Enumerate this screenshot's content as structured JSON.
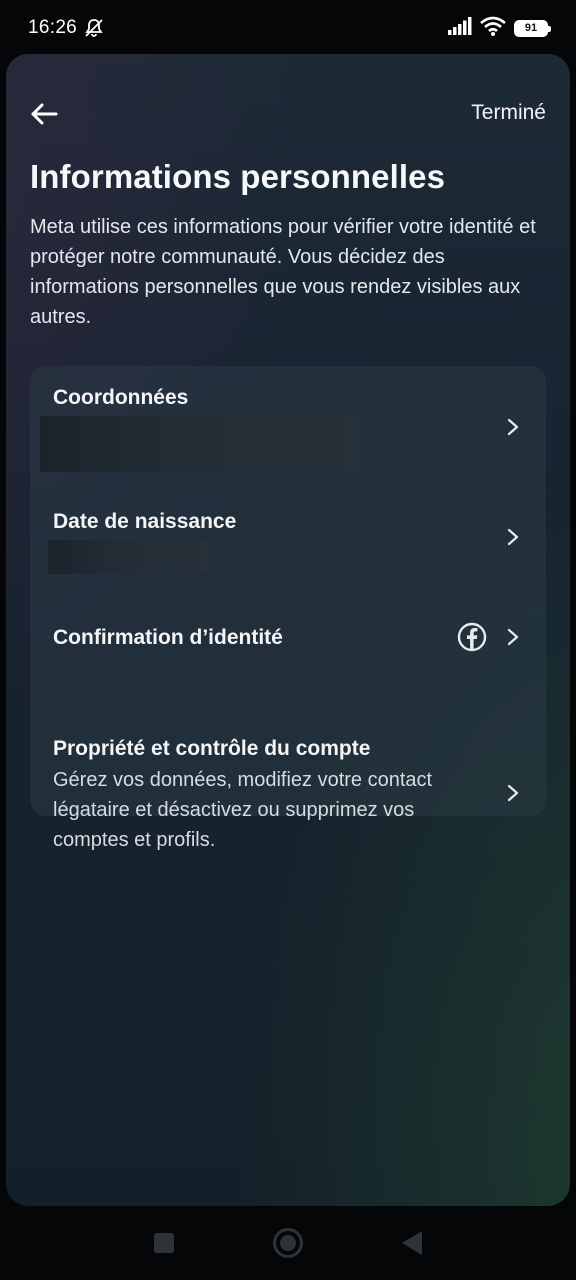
{
  "status_bar": {
    "time": "16:26",
    "battery": "91",
    "icons": [
      "notifications-muted-icon",
      "signal-icon",
      "wifi-icon",
      "battery-icon"
    ]
  },
  "header": {
    "back_icon": "back-arrow-icon",
    "done_label": "Terminé"
  },
  "page": {
    "title": "Informations personnelles",
    "description": "Meta utilise ces informations pour vérifier votre identité et protéger notre communauté. Vous décidez des informations personnelles que vous rendez visibles aux autres."
  },
  "items": [
    {
      "title": "Coordonnées"
    },
    {
      "title": "Date de naissance"
    },
    {
      "title": "Confirmation d’identité",
      "icon": "facebook-icon"
    },
    {
      "title": "Propriété et contrôle du compte",
      "subtitle": "Gérez vos données, modifiez votre contact légataire et désactivez ou supprimez vos comptes et profils."
    }
  ],
  "nav": {
    "buttons": [
      "recents-square-icon",
      "home-circle-icon",
      "back-triangle-icon"
    ]
  },
  "colors": {
    "sheet_bg": "#172330",
    "card_bg": "#2c3a46",
    "text": "#f2f4f6"
  }
}
